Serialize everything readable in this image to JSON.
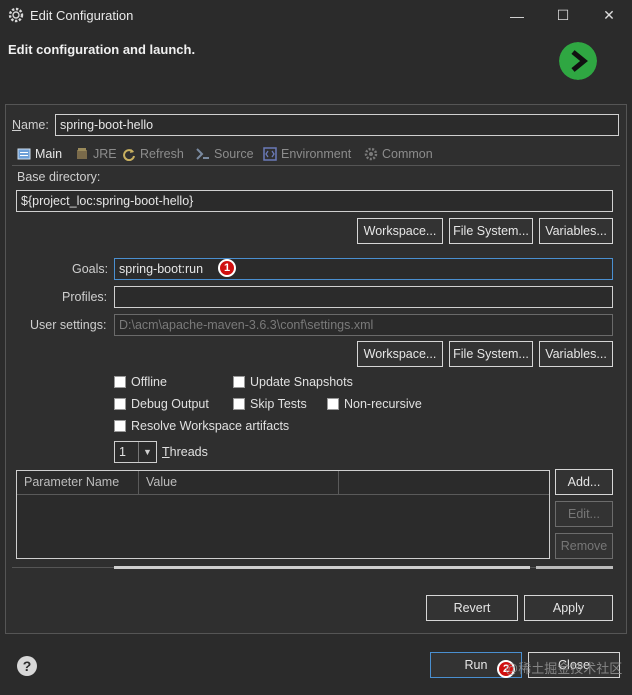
{
  "window": {
    "title": "Edit Configuration",
    "minimize_glyph": "—",
    "maximize_glyph": "☐",
    "close_glyph": "✕"
  },
  "header": {
    "title": "Edit configuration and launch."
  },
  "name": {
    "label": "Name:",
    "value": "spring-boot-hello"
  },
  "tabs": [
    {
      "label": "Main",
      "icon": "main-tab-icon",
      "active": true
    },
    {
      "label": "JRE",
      "icon": "jre-icon",
      "active": false
    },
    {
      "label": "Refresh",
      "icon": "refresh-icon",
      "active": false
    },
    {
      "label": "Source",
      "icon": "source-icon",
      "active": false
    },
    {
      "label": "Environment",
      "icon": "environment-icon",
      "active": false
    },
    {
      "label": "Common",
      "icon": "common-gear-icon",
      "active": false
    }
  ],
  "base_directory": {
    "label": "Base directory:",
    "value": "${project_loc:spring-boot-hello}"
  },
  "dir_buttons": {
    "workspace": "Workspace...",
    "file_system": "File System...",
    "variables": "Variables..."
  },
  "goals": {
    "label": "Goals:",
    "value": "spring-boot:run"
  },
  "profiles": {
    "label": "Profiles:",
    "value": ""
  },
  "user_settings": {
    "label": "User settings:",
    "value": "D:\\acm\\apache-maven-3.6.3\\conf\\settings.xml"
  },
  "settings_buttons": {
    "workspace": "Workspace...",
    "file_system": "File System...",
    "variables": "Variables..."
  },
  "options": {
    "offline": "Offline",
    "update_snapshots": "Update Snapshots",
    "debug_output": "Debug Output",
    "skip_tests": "Skip Tests",
    "non_recursive": "Non-recursive",
    "resolve_workspace": "Resolve Workspace artifacts"
  },
  "threads": {
    "value": "1",
    "label": "Threads"
  },
  "parameters": {
    "columns": [
      "Parameter Name",
      "Value"
    ],
    "add": "Add...",
    "edit": "Edit...",
    "remove": "Remove"
  },
  "actions": {
    "revert": "Revert",
    "apply": "Apply",
    "run": "Run",
    "close": "Close",
    "help_glyph": "?"
  },
  "markers": [
    "1",
    "2"
  ],
  "watermark": "@稀土掘金技术社区",
  "colors": {
    "background": "#2b2b2b",
    "run_badge": "#2fa742",
    "marker": "#d01010"
  }
}
